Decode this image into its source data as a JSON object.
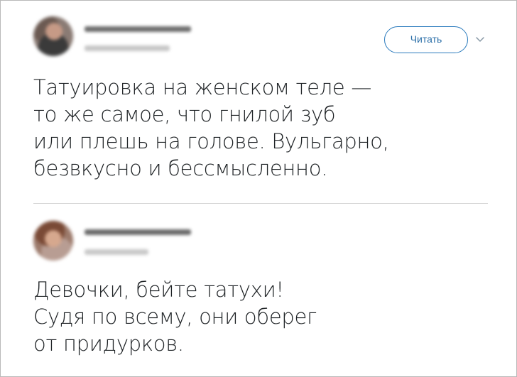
{
  "tweets": [
    {
      "follow_label": "Читать",
      "text": "Татуировка на женском теле —\nто же самое, что гнилой зуб\nили плешь на голове. Вульгарно,\nбезвкусно и бессмысленно."
    },
    {
      "text": "Девочки, бейте татухи!\nСудя по всему, они оберег\nот придурков."
    }
  ],
  "icons": {
    "follow_menu": "chevron-down-icon"
  },
  "colors": {
    "accent": "#2b7bbd",
    "text": "#1f2326",
    "divider": "#d4d4d4"
  }
}
